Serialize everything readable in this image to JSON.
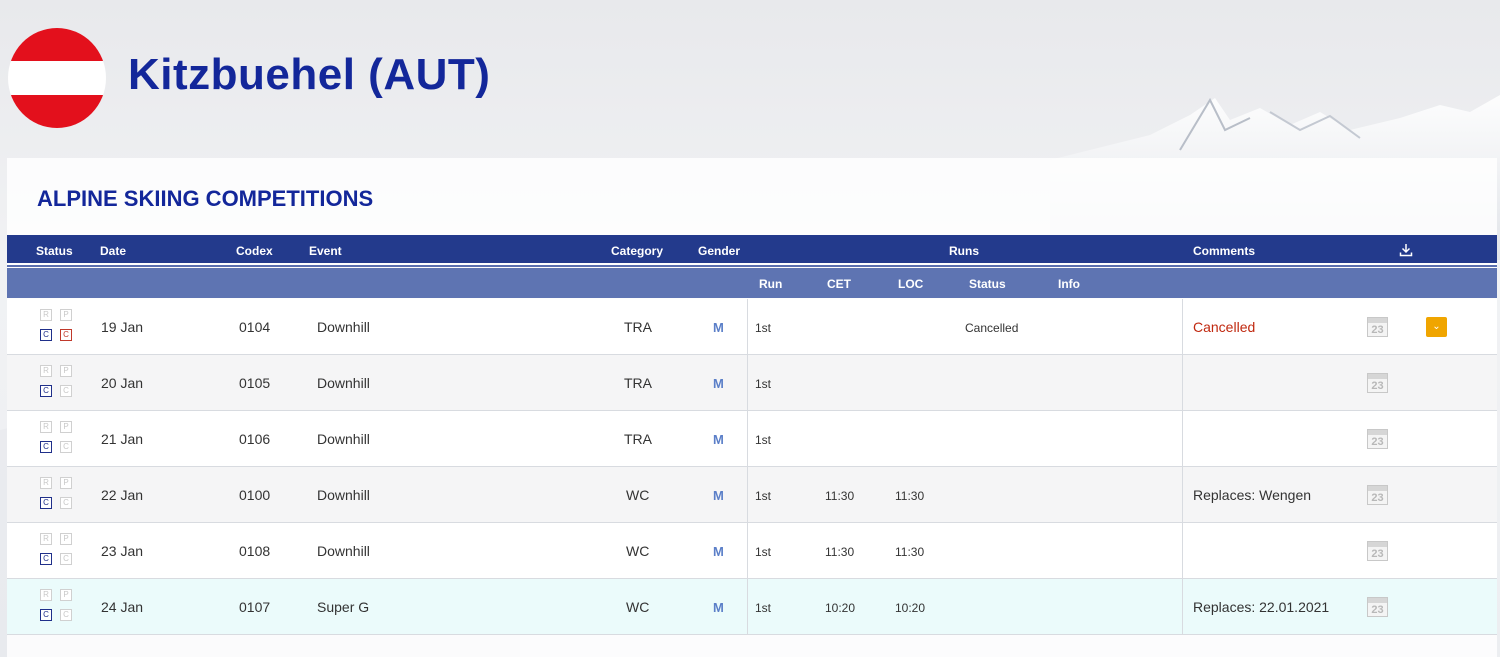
{
  "place": {
    "title": "Kitzbuehel (AUT)"
  },
  "section": {
    "title": "ALPINE SKIING COMPETITIONS"
  },
  "headers": {
    "status": "Status",
    "date": "Date",
    "codex": "Codex",
    "event": "Event",
    "category": "Category",
    "gender": "Gender",
    "runs": "Runs",
    "comments": "Comments"
  },
  "subheaders": {
    "run": "Run",
    "cet": "CET",
    "loc": "LOC",
    "status": "Status",
    "info": "Info"
  },
  "badges": {
    "r": "R",
    "p": "P",
    "c": "C",
    "c2": "C"
  },
  "calendar_day": "23",
  "rows": [
    {
      "date": "19 Jan",
      "codex": "0104",
      "event": "Downhill",
      "category": "TRA",
      "gender": "M",
      "run": "1st",
      "cet": "",
      "loc": "",
      "run_status": "Cancelled",
      "comment": "Cancelled"
    },
    {
      "date": "20 Jan",
      "codex": "0105",
      "event": "Downhill",
      "category": "TRA",
      "gender": "M",
      "run": "1st",
      "cet": "",
      "loc": "",
      "run_status": "",
      "comment": ""
    },
    {
      "date": "21 Jan",
      "codex": "0106",
      "event": "Downhill",
      "category": "TRA",
      "gender": "M",
      "run": "1st",
      "cet": "",
      "loc": "",
      "run_status": "",
      "comment": ""
    },
    {
      "date": "22 Jan",
      "codex": "0100",
      "event": "Downhill",
      "category": "WC",
      "gender": "M",
      "run": "1st",
      "cet": "11:30",
      "loc": "11:30",
      "run_status": "",
      "comment": "Replaces: Wengen"
    },
    {
      "date": "23 Jan",
      "codex": "0108",
      "event": "Downhill",
      "category": "WC",
      "gender": "M",
      "run": "1st",
      "cet": "11:30",
      "loc": "11:30",
      "run_status": "",
      "comment": ""
    },
    {
      "date": "24 Jan",
      "codex": "0107",
      "event": "Super G",
      "category": "WC",
      "gender": "M",
      "run": "1st",
      "cet": "10:20",
      "loc": "10:20",
      "run_status": "",
      "comment": "Replaces: 22.01.2021"
    }
  ],
  "icons": {
    "download": "download-icon",
    "calendar": "calendar-icon",
    "dropdown": "chevron-down-icon",
    "flag": "austria-flag"
  },
  "colors": {
    "title": "#13279a",
    "header_bg": "#233a8c",
    "subheader_bg": "#5e74b2",
    "cancel": "#c0280f",
    "accent": "#f0a500"
  }
}
